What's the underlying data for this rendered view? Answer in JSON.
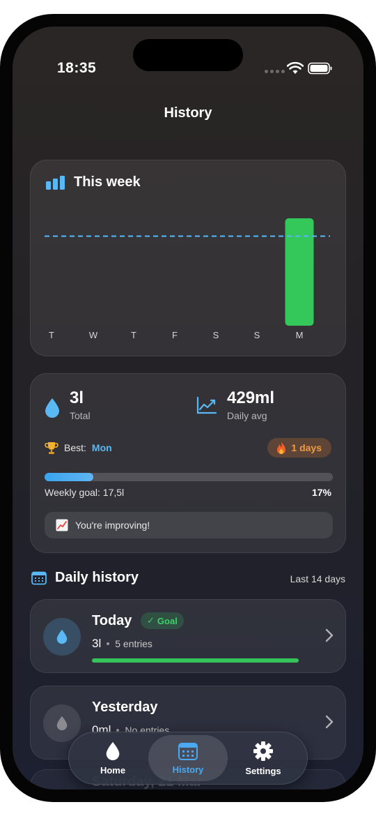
{
  "status_bar": {
    "time": "18:35"
  },
  "header": {
    "title": "History"
  },
  "week_chart": {
    "title": "This week",
    "chart_data": {
      "type": "bar",
      "categories": [
        "T",
        "W",
        "T",
        "F",
        "S",
        "S",
        "M"
      ],
      "values": [
        0,
        0,
        0,
        0,
        0,
        0,
        3000
      ],
      "goal_line": 2500,
      "ylim": [
        0,
        3000
      ],
      "colors": {
        "bar": "#34c759",
        "goal_line": "#5ab8f5"
      }
    }
  },
  "stats": {
    "total_value": "3l",
    "total_label": "Total",
    "avg_value": "429ml",
    "avg_label": "Daily avg",
    "best_label": "Best:",
    "best_value": "Mon",
    "streak": "1 days",
    "goal_label": "Weekly goal: 17,5l",
    "goal_percent": "17%",
    "goal_fraction": 0.17,
    "improving": "You're improving!"
  },
  "daily_history": {
    "title": "Daily history",
    "range": "Last 14 days",
    "days": [
      {
        "title": "Today",
        "badge": "Goal",
        "amount": "3l",
        "entries": "5 entries",
        "progress": 1.0
      },
      {
        "title": "Yesterday",
        "amount": "0ml",
        "entries": "No entries"
      },
      {
        "title": "Saturday, 21 Mar"
      }
    ]
  },
  "tabbar": {
    "home": "Home",
    "history": "History",
    "settings": "Settings"
  },
  "colors": {
    "accent": "#4aa9f0",
    "green": "#34c759",
    "orange": "#f09a45"
  }
}
